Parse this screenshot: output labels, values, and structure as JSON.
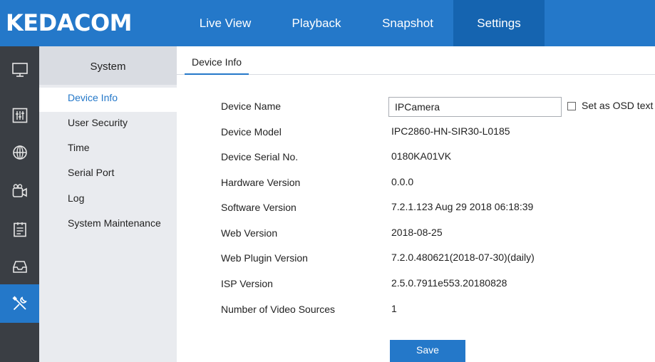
{
  "brand": {
    "logo_text": "KEDACOM"
  },
  "nav": {
    "tabs": [
      "Live View",
      "Playback",
      "Snapshot",
      "Settings"
    ],
    "active": "Settings"
  },
  "rail": {
    "icons": [
      "monitor-icon",
      "adjust-icon",
      "network-globe-icon",
      "camera-icon",
      "event-calendar-icon",
      "storage-icon",
      "tools-icon"
    ],
    "active": "tools-icon"
  },
  "sidebar": {
    "title": "System",
    "items": [
      "Device Info",
      "User Security",
      "Time",
      "Serial Port",
      "Log",
      "System Maintenance"
    ],
    "active": "Device Info"
  },
  "content": {
    "tab": "Device Info",
    "device_name_label": "Device Name",
    "device_name_value": "IPCamera",
    "osd_label": "Set as OSD text",
    "osd_checked": false,
    "fields": [
      {
        "label": "Device Model",
        "value": "IPC2860-HN-SIR30-L0185"
      },
      {
        "label": "Device Serial No.",
        "value": "0180KA01VK"
      },
      {
        "label": "Hardware Version",
        "value": "0.0.0"
      },
      {
        "label": "Software Version",
        "value": "7.2.1.123 Aug 29 2018 06:18:39"
      },
      {
        "label": "Web Version",
        "value": "2018-08-25"
      },
      {
        "label": "Web Plugin Version",
        "value": "7.2.0.480621(2018-07-30)(daily)"
      },
      {
        "label": "ISP Version",
        "value": "2.5.0.7911e553.20180828"
      },
      {
        "label": "Number of Video Sources",
        "value": "1"
      }
    ],
    "save_label": "Save"
  },
  "colors": {
    "accent": "#2478c9",
    "accent_dark": "#1564b0",
    "rail_bg": "#3a3e44",
    "sidebar_bg": "#e9ebef"
  }
}
